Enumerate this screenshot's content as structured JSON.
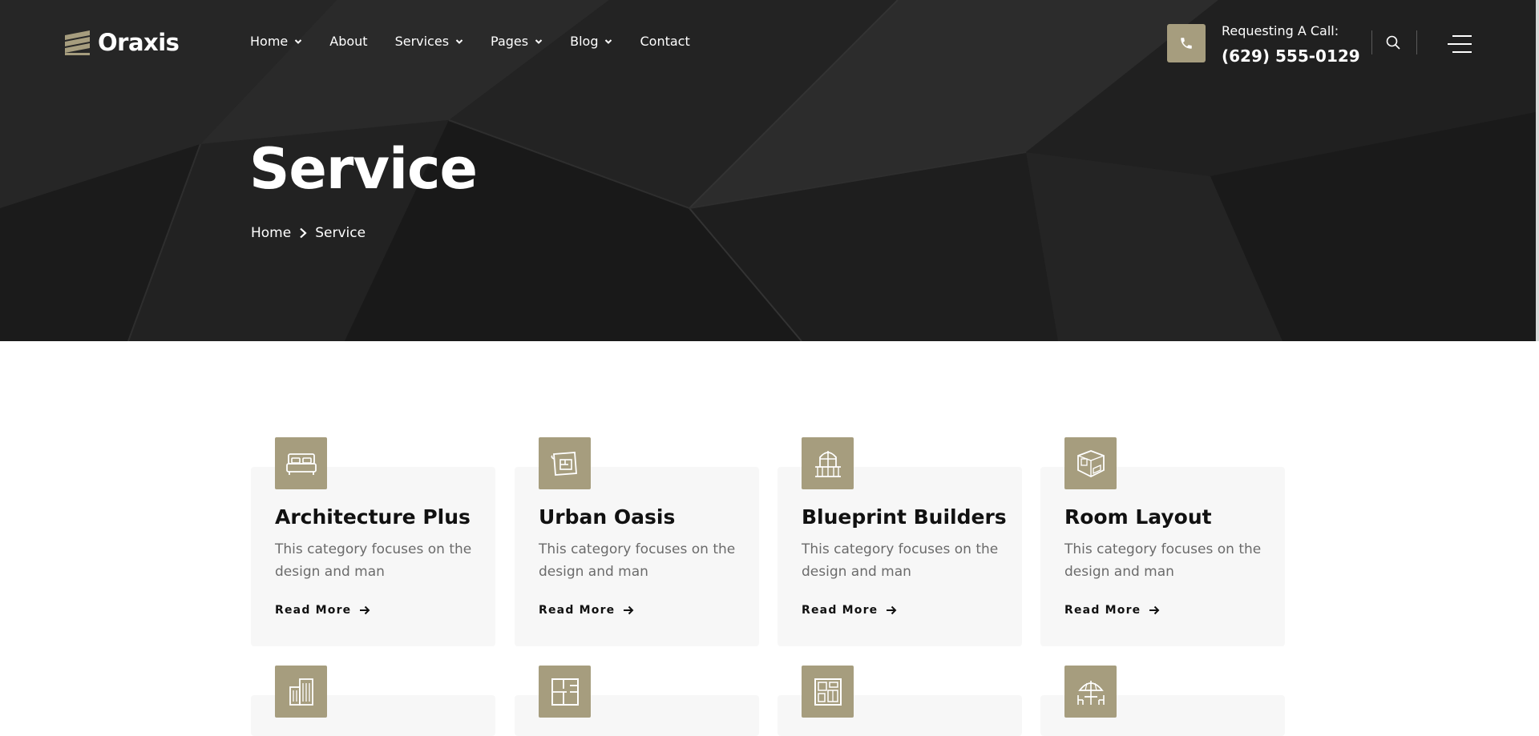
{
  "brand": {
    "name": "Oraxis",
    "accent": "#a69d7e"
  },
  "nav": {
    "items": [
      {
        "label": "Home",
        "dropdown": true
      },
      {
        "label": "About",
        "dropdown": false
      },
      {
        "label": "Services",
        "dropdown": true
      },
      {
        "label": "Pages",
        "dropdown": true
      },
      {
        "label": "Blog",
        "dropdown": true
      },
      {
        "label": "Contact",
        "dropdown": false
      }
    ]
  },
  "contact": {
    "label": "Requesting A Call:",
    "phone": "(629) 555-0129",
    "icon": "phone-icon"
  },
  "hero": {
    "title": "Service",
    "breadcrumb": {
      "home": "Home",
      "current": "Service"
    }
  },
  "services": [
    {
      "title": "Architecture Plus",
      "description": "This category focuses on the design and man",
      "link": "Read More",
      "icon": "bed-icon"
    },
    {
      "title": "Urban Oasis",
      "description": "This category focuses on the design and man",
      "link": "Read More",
      "icon": "blueprint-icon"
    },
    {
      "title": "Blueprint Builders",
      "description": "This category focuses on the design and man",
      "link": "Read More",
      "icon": "balcony-door-icon"
    },
    {
      "title": "Room Layout",
      "description": "This category focuses on the design and man",
      "link": "Read More",
      "icon": "room-isometric-icon"
    },
    {
      "title": "",
      "description": "",
      "link": "",
      "icon": "buildings-icon"
    },
    {
      "title": "",
      "description": "",
      "link": "",
      "icon": "floor-plan-icon"
    },
    {
      "title": "",
      "description": "",
      "link": "",
      "icon": "floor-layout-icon"
    },
    {
      "title": "",
      "description": "",
      "link": "",
      "icon": "patio-umbrella-icon"
    }
  ]
}
